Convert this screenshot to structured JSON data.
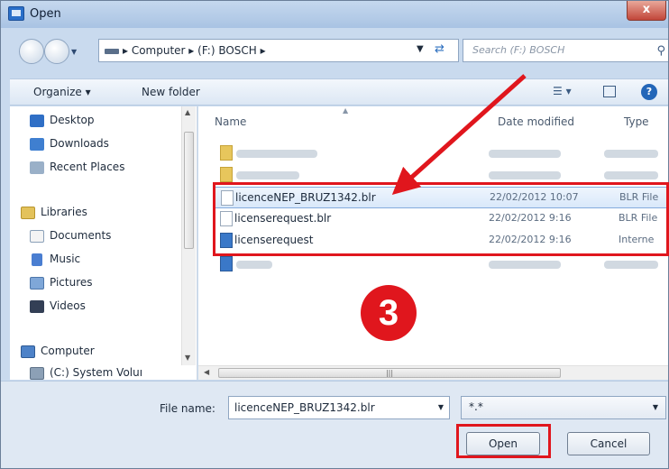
{
  "window": {
    "title": "Open",
    "close_label": "x"
  },
  "address": {
    "path": "▸ Computer ▸ (F:) BOSCH ▸",
    "search_placeholder": "Search (F:) BOSCH"
  },
  "toolbar": {
    "organize_label": "Organize ▾",
    "new_folder_label": "New folder"
  },
  "sidebar": {
    "items": [
      {
        "label": "Desktop",
        "icon": "desktop-icon"
      },
      {
        "label": "Downloads",
        "icon": "downloads-icon"
      },
      {
        "label": "Recent Places",
        "icon": "recent-places-icon"
      },
      {
        "label": "Libraries",
        "icon": "libraries-icon"
      },
      {
        "label": "Documents",
        "icon": "documents-icon"
      },
      {
        "label": "Music",
        "icon": "music-icon"
      },
      {
        "label": "Pictures",
        "icon": "pictures-icon"
      },
      {
        "label": "Videos",
        "icon": "videos-icon"
      },
      {
        "label": "Computer",
        "icon": "computer-icon"
      },
      {
        "label": "(C:) System Voluı",
        "icon": "drive-icon"
      }
    ]
  },
  "filelist": {
    "columns": {
      "name": "Name",
      "date": "Date modified",
      "type": "Type"
    },
    "files": [
      {
        "name": "licenceNEP_BRUZ1342.blr",
        "date": "22/02/2012 10:07",
        "type": "BLR File"
      },
      {
        "name": "licenserequest.blr",
        "date": "22/02/2012 9:16",
        "type": "BLR File"
      },
      {
        "name": "licenserequest",
        "date": "22/02/2012 9:16",
        "type": "Interne"
      }
    ]
  },
  "bottom": {
    "filename_label": "File name:",
    "filename_value": "licenceNEP_BRUZ1342.blr",
    "filter_value": "*.*",
    "open_label": "Open",
    "cancel_label": "Cancel"
  },
  "annotation": {
    "step_number": "3",
    "color": "#e0161d"
  }
}
